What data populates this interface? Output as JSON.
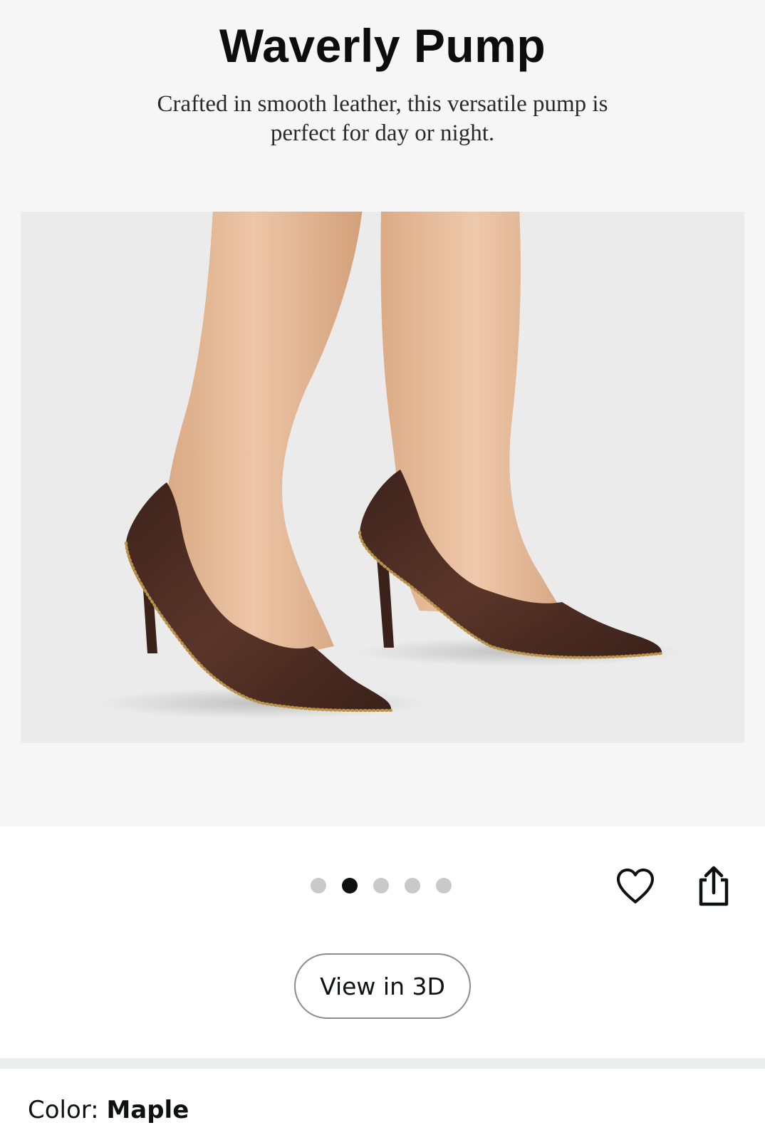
{
  "hero": {
    "title": "Waverly Pump",
    "description": "Crafted in smooth leather, this versatile pump is perfect for day or night."
  },
  "image_carousel": {
    "total": 5,
    "active_index": 1
  },
  "actions": {
    "wishlist_icon": "heart-icon",
    "share_icon": "share-icon",
    "view_3d_label": "View in 3D"
  },
  "variant": {
    "label": "Color: ",
    "value": "Maple"
  },
  "colors": {
    "shoe": "#4a2b22",
    "skin": "#e3b896",
    "photo_background": "#ebebeb"
  }
}
